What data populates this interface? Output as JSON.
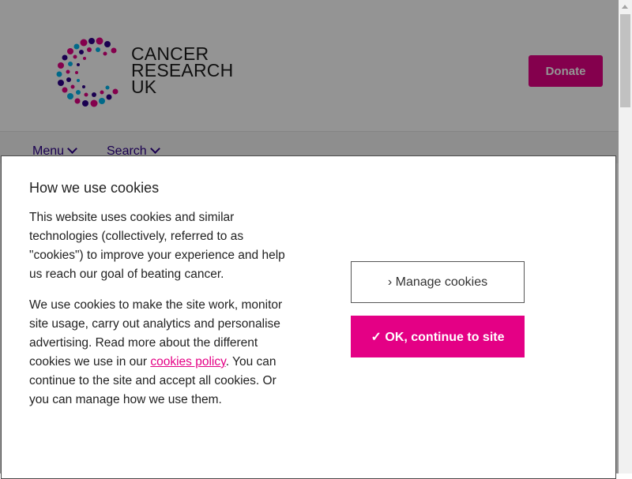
{
  "header": {
    "logo_lines": [
      "CANCER",
      "RESEARCH",
      "UK"
    ],
    "donate_label": "Donate"
  },
  "nav": {
    "menu_label": "Menu",
    "search_label": "Search"
  },
  "cookie_dialog": {
    "title": "How we use cookies",
    "paragraph1": "This website uses cookies and similar technologies (collectively, referred to as \"cookies\") to improve your experience and help us reach our goal of beating cancer.",
    "paragraph2_before": "We use cookies to make the site work, monitor site usage, carry out analytics and personalise advertising. Read more about the different cookies we use in our ",
    "policy_link": "cookies policy",
    "paragraph2_after": ". You can continue to the site and accept all cookies. Or you can manage how we use them.",
    "manage_label": "› Manage cookies",
    "ok_label": "✓ OK, continue to site"
  },
  "colors": {
    "brand_pink": "#e40085",
    "brand_purple": "#2e008b",
    "brand_blue": "#00b6ed"
  }
}
